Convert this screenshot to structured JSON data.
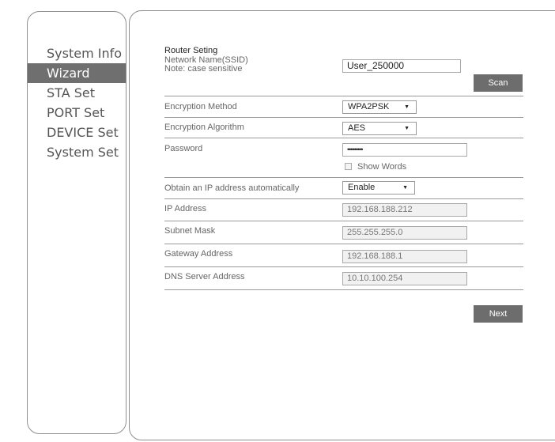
{
  "sidebar": {
    "items": [
      {
        "label": "System Info",
        "active": false
      },
      {
        "label": "Wizard",
        "active": true
      },
      {
        "label": "STA Set",
        "active": false
      },
      {
        "label": "PORT Set",
        "active": false
      },
      {
        "label": "DEVICE Set",
        "active": false
      },
      {
        "label": "System Set",
        "active": false
      }
    ]
  },
  "form": {
    "title": "Router Seting",
    "ssid_label": "Network Name(SSID)",
    "ssid_note": "Note: case sensitive",
    "ssid_value": "User_250000",
    "scan_label": "Scan",
    "encryption_method_label": "Encryption Method",
    "encryption_method_value": "WPA2PSK",
    "encryption_algorithm_label": "Encryption Algorithm",
    "encryption_algorithm_value": "AES",
    "password_label": "Password",
    "password_value": "•••••••••",
    "show_words_label": "Show Words",
    "dhcp_label": "Obtain an IP address automatically",
    "dhcp_value": "Enable",
    "ip_label": "IP Address",
    "ip_value": "192.168.188.212",
    "mask_label": "Subnet Mask",
    "mask_value": "255.255.255.0",
    "gateway_label": "Gateway Address",
    "gateway_value": "192.168.188.1",
    "dns_label": "DNS Server Address",
    "dns_value": "10.10.100.254",
    "next_label": "Next"
  },
  "icons": {
    "dropdown": "chevron-down-icon"
  },
  "colors": {
    "active_nav": "#6f6f6f",
    "button": "#6d6d6d",
    "border": "#8e8e8e"
  }
}
